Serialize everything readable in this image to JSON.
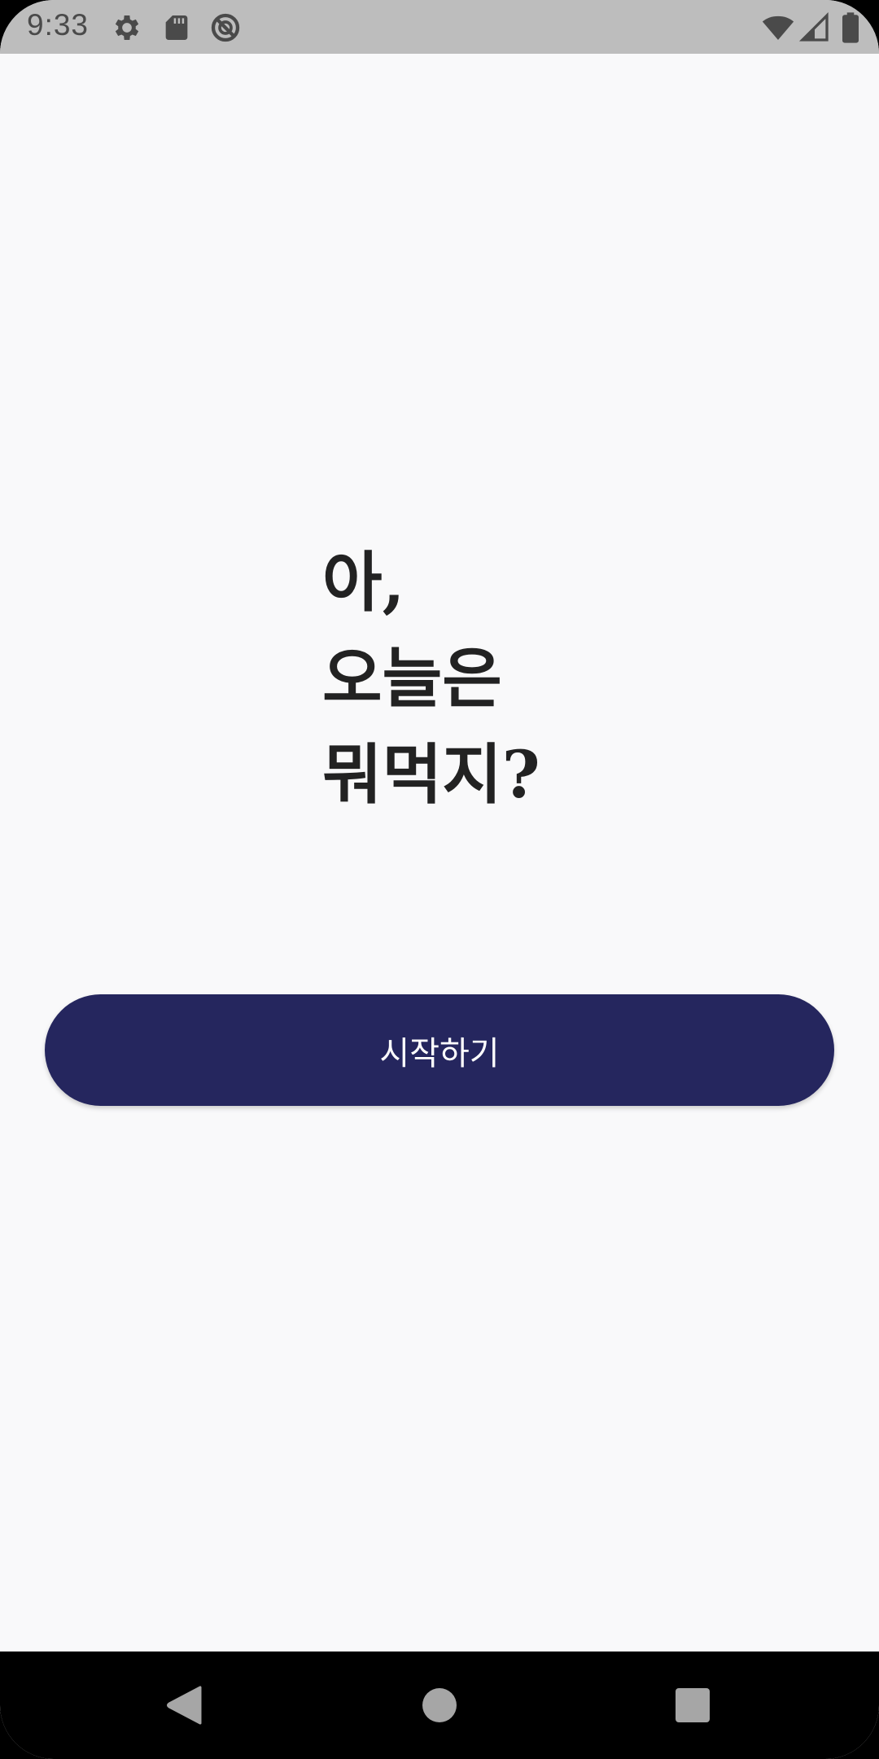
{
  "status_bar": {
    "time": "9:33",
    "left_icons": [
      "settings-icon",
      "sd-card-icon",
      "do-not-disturb-icon"
    ],
    "right_icons": [
      "wifi-icon",
      "cellular-signal-icon",
      "battery-icon"
    ],
    "background_color": "#bdbdbd"
  },
  "main": {
    "headline_lines": [
      "아,",
      "오늘은",
      "뭐먹지?"
    ],
    "start_button_label": "시작하기",
    "button_color": "#25265e",
    "background_color": "#f9f9fa"
  },
  "nav_bar": {
    "buttons": [
      "back-icon",
      "home-icon",
      "recents-icon"
    ]
  }
}
